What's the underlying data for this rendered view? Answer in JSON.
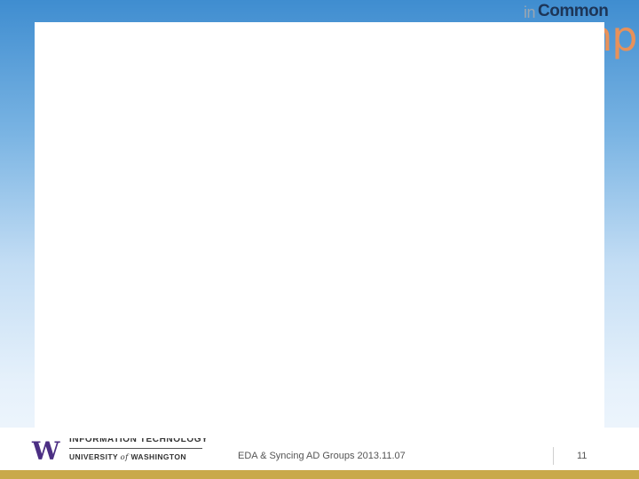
{
  "logo": {
    "in": "in",
    "common": "Common",
    "word": "camp"
  },
  "footer": {
    "department": "INFORMATION TECHNOLOGY",
    "university_prefix": "UNIVERSITY",
    "university_of": "of",
    "university_suffix": "WASHINGTON",
    "title": "EDA & Syncing AD Groups 2013.11.07",
    "page_number": "11"
  },
  "colors": {
    "brand_purple": "#4b2e83",
    "brand_gold": "#c9a94a",
    "logo_orange": "#e8915a"
  }
}
